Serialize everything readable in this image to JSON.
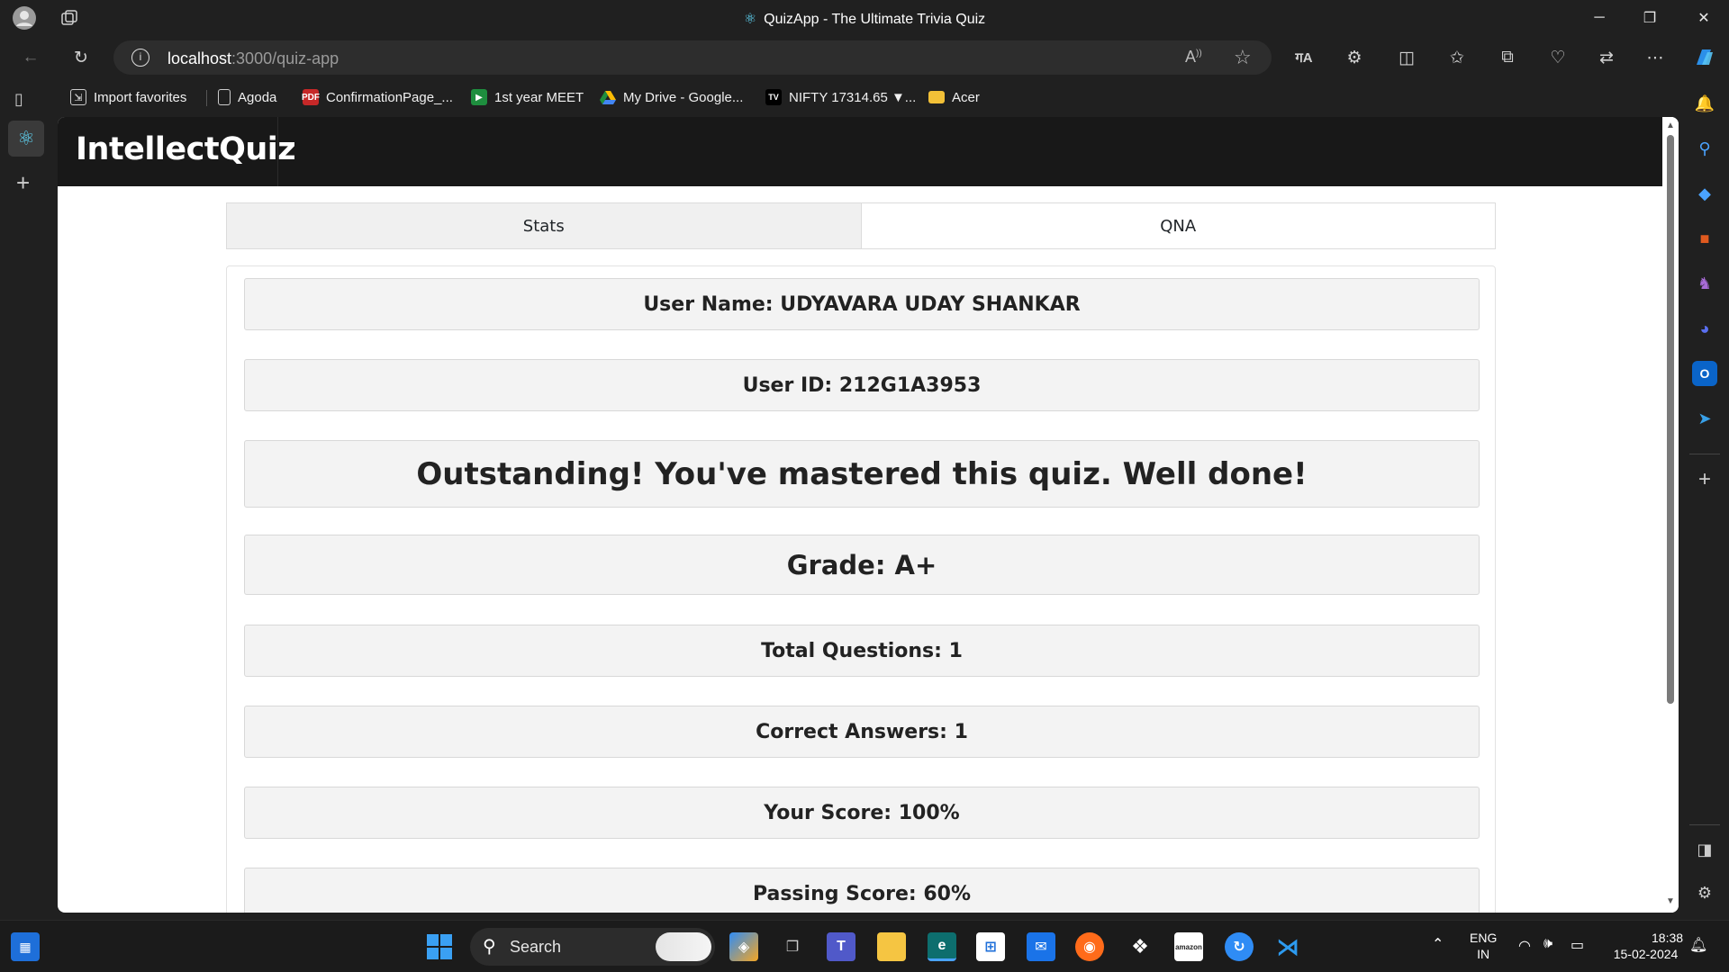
{
  "window": {
    "title": "QuizApp - The Ultimate Trivia Quiz"
  },
  "browser": {
    "url_host": "localhost",
    "url_path": ":3000/quiz-app",
    "favorites": [
      {
        "label": "Import favorites",
        "icon": "import-icon"
      },
      {
        "label": "Agoda",
        "icon": "page-icon"
      },
      {
        "label": "ConfirmationPage_...",
        "icon": "pdf-icon"
      },
      {
        "label": "1st year MEET",
        "icon": "meet-icon"
      },
      {
        "label": "My Drive - Google...",
        "icon": "drive-icon"
      },
      {
        "label": "NIFTY 17314.65 ▼...",
        "icon": "tradingview-icon"
      },
      {
        "label": "Acer",
        "icon": "folder-icon"
      }
    ]
  },
  "app": {
    "brand": "IntellectQuiz",
    "tabs": [
      {
        "label": "Stats",
        "active": true
      },
      {
        "label": "QNA",
        "active": false
      }
    ],
    "stats": {
      "user_name": "User Name: UDYAVARA UDAY SHANKAR",
      "user_id": "User ID: 212G1A3953",
      "message": "Outstanding! You've mastered this quiz. Well done!",
      "grade": "Grade: A+",
      "total_questions": "Total Questions: 1",
      "correct_answers": "Correct Answers: 1",
      "your_score": "Your Score: 100%",
      "passing_score": "Passing Score: 60%"
    }
  },
  "taskbar": {
    "search_label": "Search",
    "lang_line1": "ENG",
    "lang_line2": "IN",
    "time": "18:38",
    "date": "15-02-2024"
  },
  "colors": {
    "navbar_bg": "#181818",
    "row_bg": "#f3f3f3",
    "active_tab_bg": "#f0f0f0"
  }
}
